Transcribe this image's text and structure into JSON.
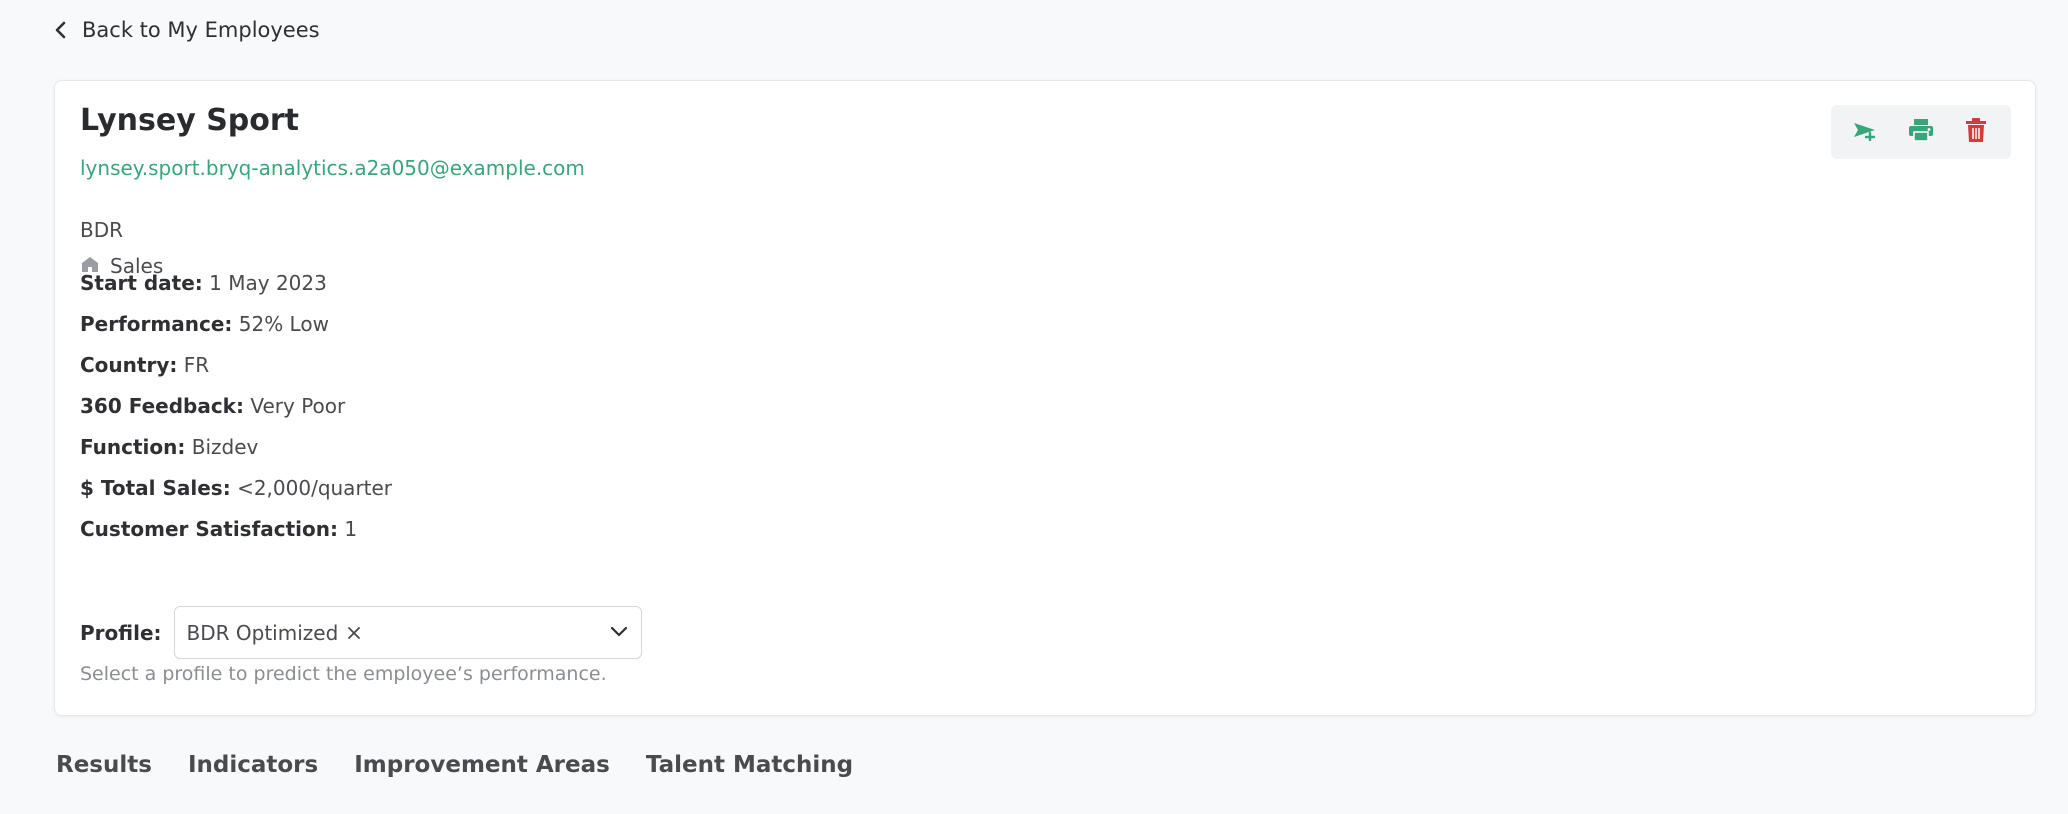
{
  "nav": {
    "back_label": "Back to My Employees"
  },
  "employee": {
    "name": "Lynsey Sport",
    "email": "lynsey.sport.bryq-analytics.a2a050@example.com",
    "role": "BDR",
    "department": "Sales"
  },
  "details": [
    {
      "label": "Start date:",
      "value": "1 May 2023"
    },
    {
      "label": "Performance:",
      "value": "52% Low"
    },
    {
      "label": "Country:",
      "value": "FR"
    },
    {
      "label": "360 Feedback:",
      "value": "Very Poor"
    },
    {
      "label": "Function:",
      "value": "Bizdev"
    },
    {
      "label": "$ Total Sales:",
      "value": "<2,000/quarter"
    },
    {
      "label": "Customer Satisfaction:",
      "value": "1"
    }
  ],
  "profile": {
    "label": "Profile:",
    "selected": "BDR Optimized",
    "help": "Select a profile to predict the employee’s performance."
  },
  "actions": {
    "send_icon": "send-plus-icon",
    "print_icon": "printer-icon",
    "delete_icon": "trash-icon",
    "accent_color": "#3aa57b",
    "danger_color": "#d63b3b"
  },
  "tabs": [
    {
      "label": "Results"
    },
    {
      "label": "Indicators"
    },
    {
      "label": "Improvement Areas"
    },
    {
      "label": "Talent Matching"
    }
  ]
}
